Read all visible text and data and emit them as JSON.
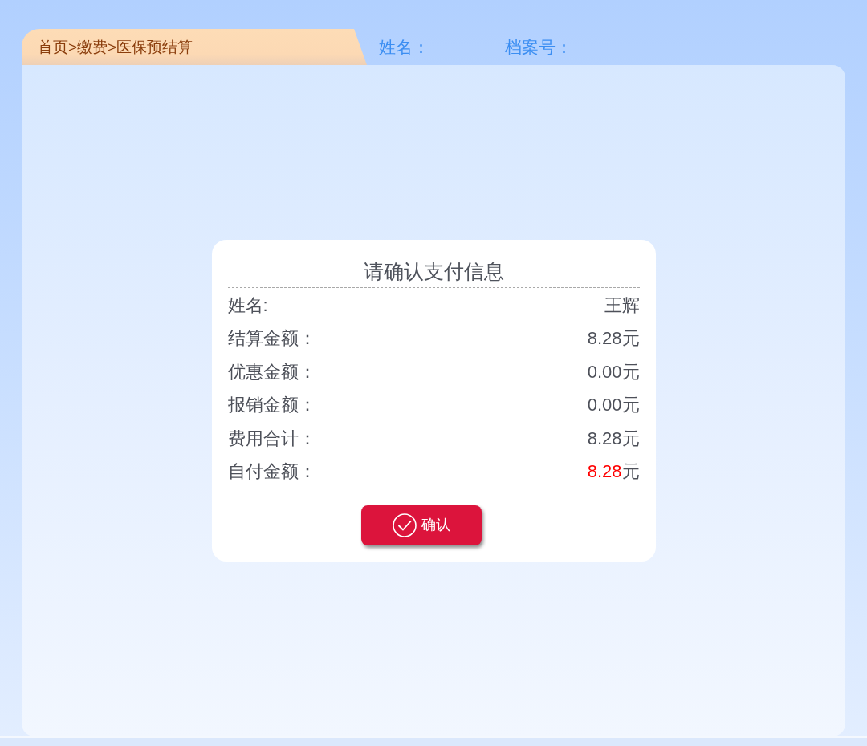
{
  "breadcrumb": "首页>缴费>医保预结算",
  "header_fields": [
    {
      "label": "姓名："
    },
    {
      "label": "档案号："
    }
  ],
  "dialog": {
    "title": "请确认支付信息",
    "rows": [
      {
        "kind": "text",
        "label": "姓名:",
        "value": "王辉"
      },
      {
        "kind": "amount",
        "label": "结算金额：",
        "amount": "8.28",
        "unit": "元",
        "highlight": false
      },
      {
        "kind": "amount",
        "label": "优惠金额：",
        "amount": "0.00",
        "unit": "元",
        "highlight": false
      },
      {
        "kind": "amount",
        "label": "报销金额：",
        "amount": "0.00",
        "unit": "元",
        "highlight": false
      },
      {
        "kind": "amount",
        "label": "费用合计：",
        "amount": "8.28",
        "unit": "元",
        "highlight": false
      },
      {
        "kind": "amount",
        "label": "自付金额：",
        "amount": "8.28",
        "unit": "元",
        "highlight": true
      }
    ],
    "confirm_button": "确认"
  }
}
